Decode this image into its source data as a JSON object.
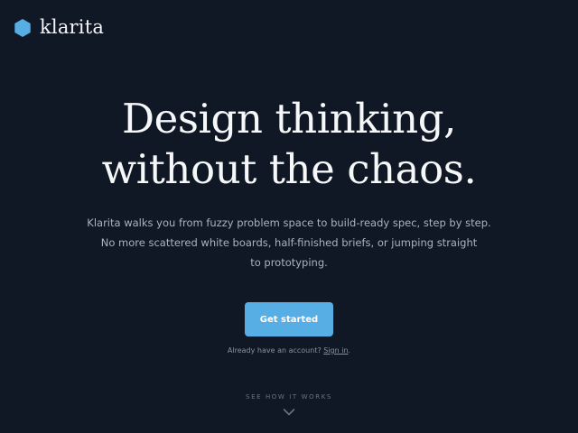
{
  "brand": {
    "name": "klarita",
    "logo_icon": "hexagon-icon",
    "accent_color": "#56aee4"
  },
  "hero": {
    "headline_line1": "Design thinking,",
    "headline_line2": "without the chaos.",
    "subtext_line1": "Klarita walks you from fuzzy problem space to build-ready spec, step by step.",
    "subtext_line2": "No more scattered white boards, half-finished briefs, or jumping straight",
    "subtext_line3": "to prototyping."
  },
  "cta": {
    "label": "Get started"
  },
  "signin": {
    "prefix": "Already have an account? ",
    "link_label": "Sign in",
    "suffix": "."
  },
  "see_how": {
    "label": "SEE HOW IT WORKS",
    "icon": "chevron-down-icon"
  }
}
